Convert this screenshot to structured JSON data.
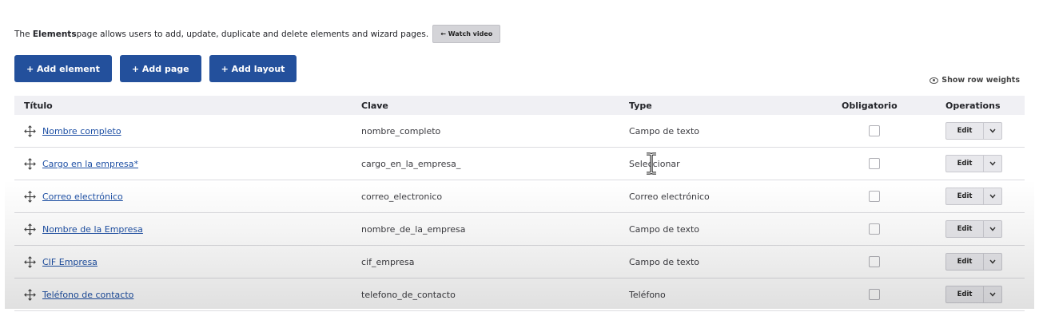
{
  "intro": {
    "prefix": "The ",
    "bold": "Elements",
    "suffix": " page allows users to add, update, duplicate and delete elements and wizard pages.",
    "watch_video_label": "← Watch video"
  },
  "actions": {
    "add_element": "+ Add element",
    "add_page": "+ Add page",
    "add_layout": "+ Add layout"
  },
  "show_row_weights": "Show row weights",
  "table": {
    "headers": {
      "title": "Título",
      "key": "Clave",
      "type": "Type",
      "required": "Obligatorio",
      "operations": "Operations"
    },
    "rows": [
      {
        "title": "Nombre completo",
        "key": "nombre_completo",
        "type": "Campo de texto",
        "required": false,
        "edit": "Edit"
      },
      {
        "title": "Cargo en la empresa*",
        "key": "cargo_en_la_empresa_",
        "type": "Seleccionar",
        "required": false,
        "edit": "Edit"
      },
      {
        "title": "Correo electrónico",
        "key": "correo_electronico",
        "type": "Correo electrónico",
        "required": false,
        "edit": "Edit"
      },
      {
        "title": "Nombre de la Empresa",
        "key": "nombre_de_la_empresa",
        "type": "Campo de texto",
        "required": false,
        "edit": "Edit"
      },
      {
        "title": "CIF Empresa",
        "key": "cif_empresa",
        "type": "Campo de texto",
        "required": false,
        "edit": "Edit"
      },
      {
        "title": "Teléfono de contacto",
        "key": "telefono_de_contacto",
        "type": "Teléfono",
        "required": false,
        "edit": "Edit"
      }
    ]
  },
  "colors": {
    "primary": "#23509c",
    "link": "#1d4fa4",
    "header_bg": "#f0f0f4"
  },
  "icons": [
    "eye-icon",
    "drag-handle-icon",
    "chevron-down-icon",
    "text-cursor-icon"
  ]
}
